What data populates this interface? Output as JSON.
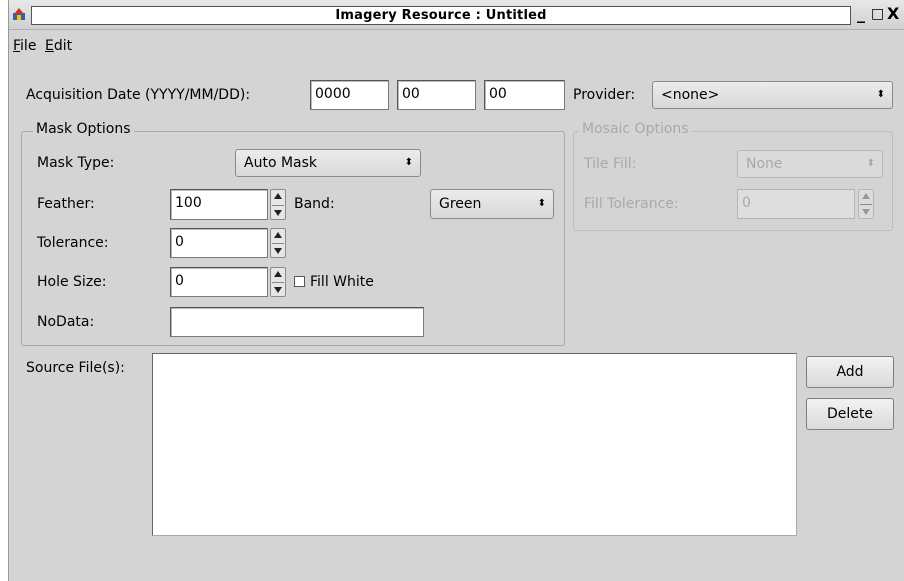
{
  "window": {
    "title": "Imagery Resource : Untitled",
    "controls": {
      "minimize": "_",
      "maximize": "□",
      "close": "X"
    }
  },
  "menubar": {
    "items": [
      {
        "label": "ile",
        "mnemonic": "F"
      },
      {
        "label": "dit",
        "mnemonic": "E"
      }
    ]
  },
  "acquisition": {
    "label": "Acquisition Date (YYYY/MM/DD):",
    "year": "0000",
    "month": "00",
    "day": "00"
  },
  "provider": {
    "label": "Provider:",
    "value": "<none>"
  },
  "mask_options": {
    "title": "Mask Options",
    "mask_type": {
      "label": "Mask Type:",
      "value": "Auto Mask"
    },
    "feather": {
      "label": "Feather:",
      "value": "100"
    },
    "band": {
      "label": "Band:",
      "value": "Green"
    },
    "tolerance": {
      "label": "Tolerance:",
      "value": "0"
    },
    "hole_size": {
      "label": "Hole Size:",
      "value": "0"
    },
    "fill_white": {
      "label": "Fill White",
      "checked": false
    },
    "nodata": {
      "label": "NoData:",
      "value": ""
    }
  },
  "mosaic_options": {
    "title": "Mosaic Options",
    "enabled": false,
    "tile_fill": {
      "label": "Tile Fill:",
      "value": "None"
    },
    "fill_tolerance": {
      "label": "Fill Tolerance:",
      "value": "0"
    }
  },
  "source_files": {
    "label": "Source File(s):",
    "items": [],
    "add_label": "Add",
    "delete_label": "Delete"
  },
  "icons": {
    "combo_arrow": "updown-arrows-icon",
    "spin": "spin-arrows-icon",
    "app": "app-icon"
  },
  "colors": {
    "window_bg": "#d4d4d4",
    "field_bg": "#ffffff",
    "disabled_text": "#a9a9a9"
  }
}
